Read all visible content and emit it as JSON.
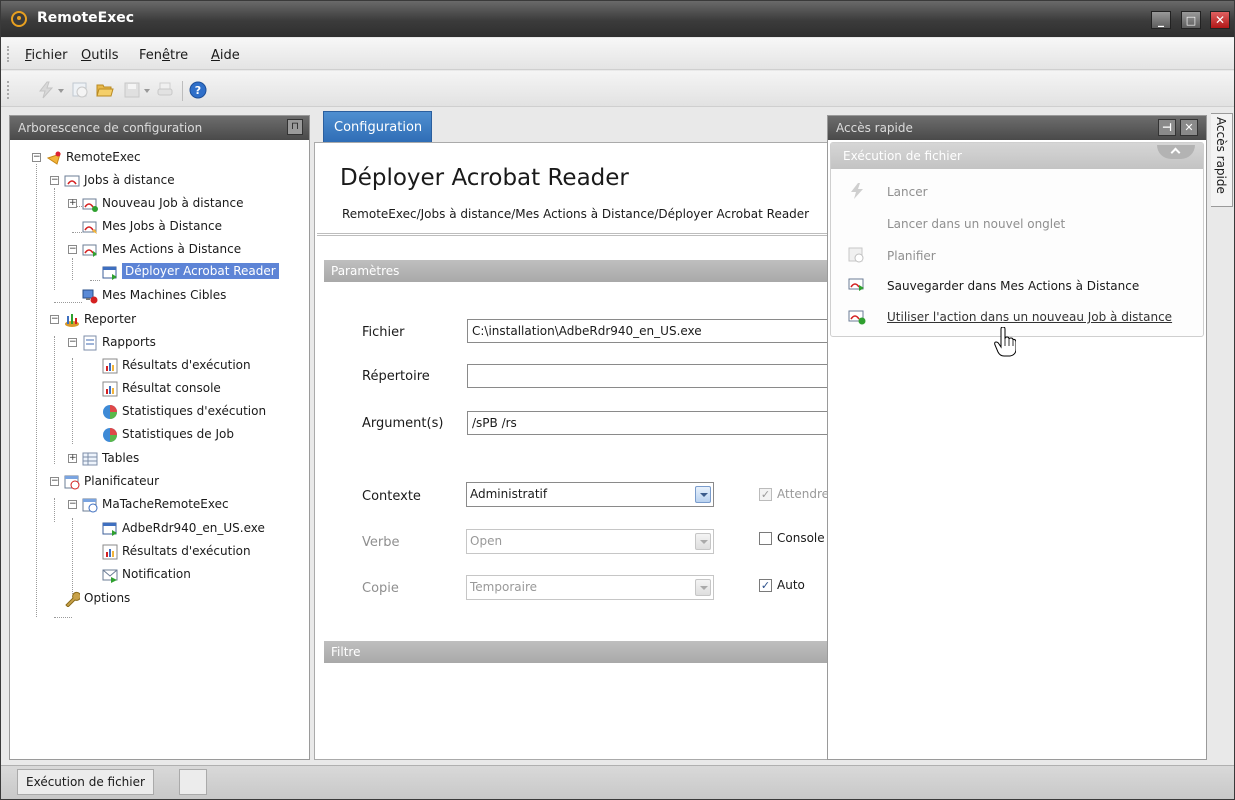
{
  "window": {
    "title": "RemoteExec"
  },
  "window_controls": {
    "minimize": "_",
    "maximize": "□",
    "close": "✕"
  },
  "menu": [
    {
      "pre": "",
      "acc": "F",
      "post": "ichier"
    },
    {
      "pre": "",
      "acc": "O",
      "post": "utils"
    },
    {
      "pre": "Fen",
      "acc": "ê",
      "post": "tre"
    },
    {
      "pre": "",
      "acc": "A",
      "post": "ide"
    }
  ],
  "toolbar": {
    "icons": [
      "run-icon",
      "schedule-icon",
      "open-folder-icon",
      "save-icon",
      "print-icon",
      "help-icon"
    ]
  },
  "left_panel": {
    "title": "Arborescence de configuration",
    "pin": "⊓",
    "tree": [
      "RemoteExec",
      "Jobs à distance",
      "Nouveau Job à distance",
      "Mes Jobs à Distance",
      "Mes Actions à Distance",
      "Déployer Acrobat Reader",
      "Mes Machines Cibles",
      "Reporter",
      "Rapports",
      "Résultats d'exécution",
      "Résultat console",
      "Statistiques d'exécution",
      "Statistiques de Job",
      "Tables",
      "Planificateur",
      "MaTacheRemoteExec",
      "AdbeRdr940_en_US.exe",
      "Résultats d'exécution",
      "Notification",
      "Options"
    ]
  },
  "center": {
    "tab": "Configuration",
    "title": "Déployer Acrobat Reader",
    "breadcrumb": "RemoteExec/Jobs à distance/Mes Actions à Distance/Déployer Acrobat Reader",
    "section_params": "Paramètres",
    "section_filter": "Filtre",
    "fields": {
      "fichier_label": "Fichier",
      "fichier_value": "C:\\installation\\AdbeRdr940_en_US.exe",
      "repertoire_label": "Répertoire",
      "repertoire_value": "",
      "arguments_label": "Argument(s)",
      "arguments_value": "/sPB /rs",
      "contexte_label": "Contexte",
      "contexte_value": "Administratif",
      "verbe_label": "Verbe",
      "verbe_value": "Open",
      "copie_label": "Copie",
      "copie_value": "Temporaire"
    },
    "checkboxes": {
      "attendre": {
        "label": "Attendre",
        "checked": true,
        "enabled": false
      },
      "console": {
        "label": "Console",
        "checked": false,
        "enabled": true
      },
      "auto": {
        "label": "Auto",
        "checked": true,
        "enabled": true
      }
    }
  },
  "right_panel": {
    "title": "Accès rapide",
    "pin": "⊣",
    "close": "✕",
    "group": "Exécution de fichier",
    "items": [
      "Lancer",
      "Lancer dans un nouvel onglet",
      "Planifier",
      "Sauvegarder dans Mes Actions à Distance",
      "Utiliser l'action dans un nouveau Job à distance"
    ],
    "side_tab": "Accès rapide"
  },
  "statusbar": {
    "text": "Exécution de fichier"
  },
  "colors": {
    "accent": "#2e6cb5",
    "selection": "#5d84d6",
    "titlebar": "#3b3b3b"
  }
}
